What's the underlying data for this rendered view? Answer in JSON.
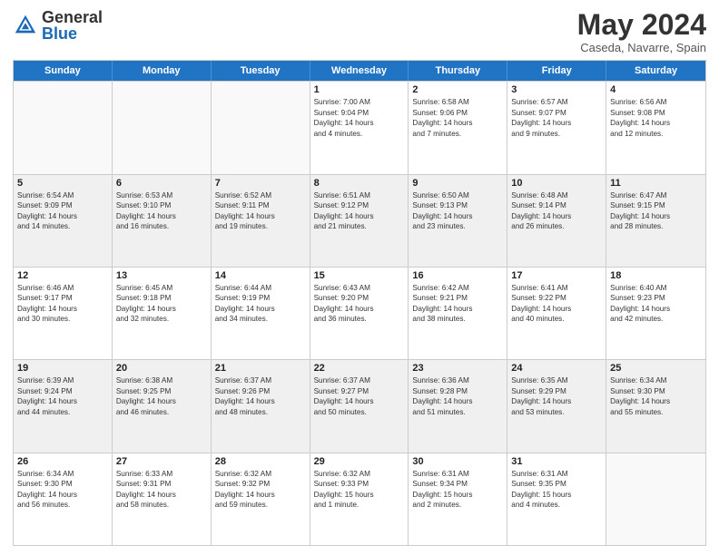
{
  "logo": {
    "general": "General",
    "blue": "Blue"
  },
  "title": "May 2024",
  "location": "Caseda, Navarre, Spain",
  "days_of_week": [
    "Sunday",
    "Monday",
    "Tuesday",
    "Wednesday",
    "Thursday",
    "Friday",
    "Saturday"
  ],
  "weeks": [
    [
      {
        "day": "",
        "empty": true
      },
      {
        "day": "",
        "empty": true
      },
      {
        "day": "",
        "empty": true
      },
      {
        "day": "1",
        "lines": [
          "Sunrise: 7:00 AM",
          "Sunset: 9:04 PM",
          "Daylight: 14 hours",
          "and 4 minutes."
        ]
      },
      {
        "day": "2",
        "lines": [
          "Sunrise: 6:58 AM",
          "Sunset: 9:06 PM",
          "Daylight: 14 hours",
          "and 7 minutes."
        ]
      },
      {
        "day": "3",
        "lines": [
          "Sunrise: 6:57 AM",
          "Sunset: 9:07 PM",
          "Daylight: 14 hours",
          "and 9 minutes."
        ]
      },
      {
        "day": "4",
        "lines": [
          "Sunrise: 6:56 AM",
          "Sunset: 9:08 PM",
          "Daylight: 14 hours",
          "and 12 minutes."
        ]
      }
    ],
    [
      {
        "day": "5",
        "lines": [
          "Sunrise: 6:54 AM",
          "Sunset: 9:09 PM",
          "Daylight: 14 hours",
          "and 14 minutes."
        ]
      },
      {
        "day": "6",
        "lines": [
          "Sunrise: 6:53 AM",
          "Sunset: 9:10 PM",
          "Daylight: 14 hours",
          "and 16 minutes."
        ]
      },
      {
        "day": "7",
        "lines": [
          "Sunrise: 6:52 AM",
          "Sunset: 9:11 PM",
          "Daylight: 14 hours",
          "and 19 minutes."
        ]
      },
      {
        "day": "8",
        "lines": [
          "Sunrise: 6:51 AM",
          "Sunset: 9:12 PM",
          "Daylight: 14 hours",
          "and 21 minutes."
        ]
      },
      {
        "day": "9",
        "lines": [
          "Sunrise: 6:50 AM",
          "Sunset: 9:13 PM",
          "Daylight: 14 hours",
          "and 23 minutes."
        ]
      },
      {
        "day": "10",
        "lines": [
          "Sunrise: 6:48 AM",
          "Sunset: 9:14 PM",
          "Daylight: 14 hours",
          "and 26 minutes."
        ]
      },
      {
        "day": "11",
        "lines": [
          "Sunrise: 6:47 AM",
          "Sunset: 9:15 PM",
          "Daylight: 14 hours",
          "and 28 minutes."
        ]
      }
    ],
    [
      {
        "day": "12",
        "lines": [
          "Sunrise: 6:46 AM",
          "Sunset: 9:17 PM",
          "Daylight: 14 hours",
          "and 30 minutes."
        ]
      },
      {
        "day": "13",
        "lines": [
          "Sunrise: 6:45 AM",
          "Sunset: 9:18 PM",
          "Daylight: 14 hours",
          "and 32 minutes."
        ]
      },
      {
        "day": "14",
        "lines": [
          "Sunrise: 6:44 AM",
          "Sunset: 9:19 PM",
          "Daylight: 14 hours",
          "and 34 minutes."
        ]
      },
      {
        "day": "15",
        "lines": [
          "Sunrise: 6:43 AM",
          "Sunset: 9:20 PM",
          "Daylight: 14 hours",
          "and 36 minutes."
        ]
      },
      {
        "day": "16",
        "lines": [
          "Sunrise: 6:42 AM",
          "Sunset: 9:21 PM",
          "Daylight: 14 hours",
          "and 38 minutes."
        ]
      },
      {
        "day": "17",
        "lines": [
          "Sunrise: 6:41 AM",
          "Sunset: 9:22 PM",
          "Daylight: 14 hours",
          "and 40 minutes."
        ]
      },
      {
        "day": "18",
        "lines": [
          "Sunrise: 6:40 AM",
          "Sunset: 9:23 PM",
          "Daylight: 14 hours",
          "and 42 minutes."
        ]
      }
    ],
    [
      {
        "day": "19",
        "lines": [
          "Sunrise: 6:39 AM",
          "Sunset: 9:24 PM",
          "Daylight: 14 hours",
          "and 44 minutes."
        ]
      },
      {
        "day": "20",
        "lines": [
          "Sunrise: 6:38 AM",
          "Sunset: 9:25 PM",
          "Daylight: 14 hours",
          "and 46 minutes."
        ]
      },
      {
        "day": "21",
        "lines": [
          "Sunrise: 6:37 AM",
          "Sunset: 9:26 PM",
          "Daylight: 14 hours",
          "and 48 minutes."
        ]
      },
      {
        "day": "22",
        "lines": [
          "Sunrise: 6:37 AM",
          "Sunset: 9:27 PM",
          "Daylight: 14 hours",
          "and 50 minutes."
        ]
      },
      {
        "day": "23",
        "lines": [
          "Sunrise: 6:36 AM",
          "Sunset: 9:28 PM",
          "Daylight: 14 hours",
          "and 51 minutes."
        ]
      },
      {
        "day": "24",
        "lines": [
          "Sunrise: 6:35 AM",
          "Sunset: 9:29 PM",
          "Daylight: 14 hours",
          "and 53 minutes."
        ]
      },
      {
        "day": "25",
        "lines": [
          "Sunrise: 6:34 AM",
          "Sunset: 9:30 PM",
          "Daylight: 14 hours",
          "and 55 minutes."
        ]
      }
    ],
    [
      {
        "day": "26",
        "lines": [
          "Sunrise: 6:34 AM",
          "Sunset: 9:30 PM",
          "Daylight: 14 hours",
          "and 56 minutes."
        ]
      },
      {
        "day": "27",
        "lines": [
          "Sunrise: 6:33 AM",
          "Sunset: 9:31 PM",
          "Daylight: 14 hours",
          "and 58 minutes."
        ]
      },
      {
        "day": "28",
        "lines": [
          "Sunrise: 6:32 AM",
          "Sunset: 9:32 PM",
          "Daylight: 14 hours",
          "and 59 minutes."
        ]
      },
      {
        "day": "29",
        "lines": [
          "Sunrise: 6:32 AM",
          "Sunset: 9:33 PM",
          "Daylight: 15 hours",
          "and 1 minute."
        ]
      },
      {
        "day": "30",
        "lines": [
          "Sunrise: 6:31 AM",
          "Sunset: 9:34 PM",
          "Daylight: 15 hours",
          "and 2 minutes."
        ]
      },
      {
        "day": "31",
        "lines": [
          "Sunrise: 6:31 AM",
          "Sunset: 9:35 PM",
          "Daylight: 15 hours",
          "and 4 minutes."
        ]
      },
      {
        "day": "",
        "empty": true
      }
    ]
  ]
}
